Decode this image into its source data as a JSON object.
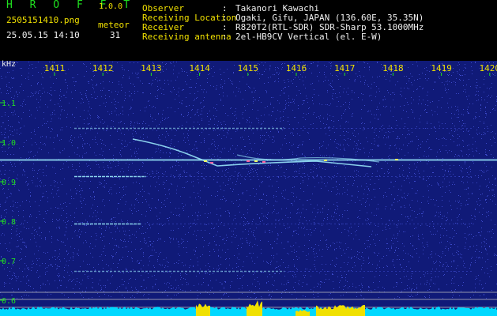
{
  "header": {
    "app_name": "H R O F F T",
    "version": "1.0.0",
    "filename": "2505151410.png",
    "datetime": "25.05.15 14:10",
    "meteor_label": "meteor",
    "meteor_count": "31"
  },
  "info": [
    {
      "label": "Observer",
      "value": "Takanori Kawachi"
    },
    {
      "label": "Receiving Location",
      "value": "Ogaki, Gifu, JAPAN (136.60E, 35.35N)"
    },
    {
      "label": "Receiver",
      "value": "R820T2(RTL-SDR) SDR-Sharp 53.1000MHz"
    },
    {
      "label": "Receiving antenna",
      "value": "2el-HB9CV Vertical (el. E-W)"
    }
  ],
  "axes": {
    "y_unit": "kHz",
    "y_ticks": [
      "1.1",
      "1.0",
      "0.9",
      "0.8",
      "0.7",
      "0.6"
    ],
    "x_ticks": [
      "1411",
      "1412",
      "1413",
      "1414",
      "1415",
      "1416",
      "1417",
      "1418",
      "1419",
      "1420"
    ]
  },
  "colors": {
    "background": "#000000",
    "spectrogram": "#101a78",
    "noise": "#3b48c8",
    "signal": "#9ff0ff",
    "signal_pink": "#ff60a0",
    "signal_yellow": "#f0ff60",
    "axis": "#20e020",
    "label_yellow": "#f0e000",
    "level_cyan": "#00d8ff",
    "level_yellow": "#f0e000"
  }
}
